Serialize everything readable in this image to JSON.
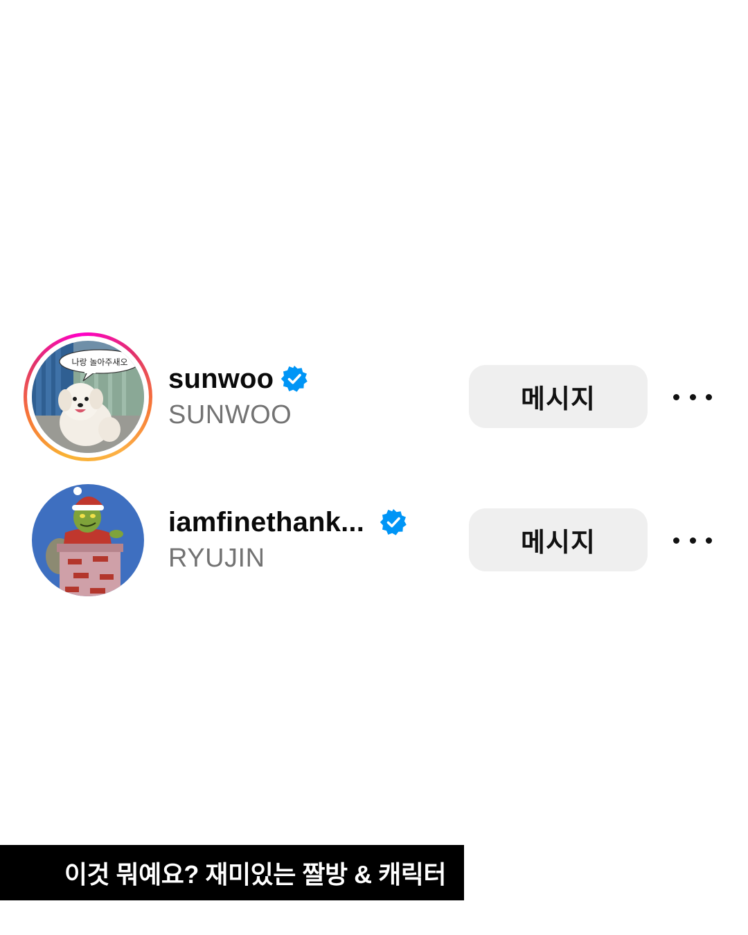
{
  "accounts": [
    {
      "username": "sunwoo",
      "display_name": "SUNWOO",
      "verified": true,
      "has_story_ring": true,
      "avatar_icon": "dog-photo-avatar",
      "avatar_speech_text": "나랑 놀아주새오",
      "message_button_label": "메시지",
      "more_icon": "ellipsis-icon"
    },
    {
      "username": "iamfinethank...",
      "display_name": "RYUJIN",
      "verified": true,
      "has_story_ring": false,
      "avatar_icon": "grinch-cartoon-avatar",
      "message_button_label": "메시지",
      "more_icon": "ellipsis-icon"
    }
  ],
  "caption": {
    "text": "이것 뭐예요? 재미있는 짤방 & 캐릭터"
  },
  "colors": {
    "verified_badge": "#0095f6",
    "button_bg": "#efefef",
    "secondary_text": "#737373",
    "caption_bg": "#000000"
  }
}
